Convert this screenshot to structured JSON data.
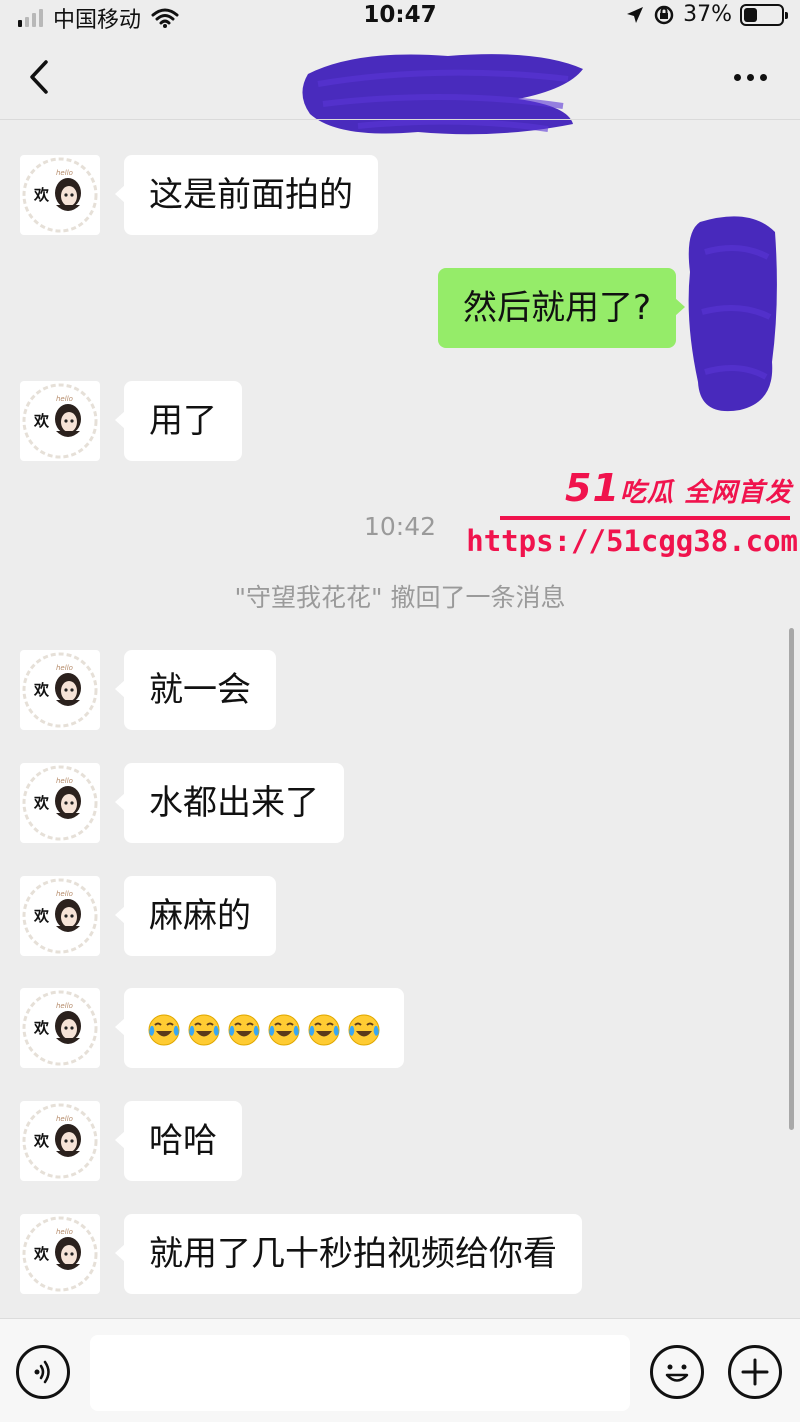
{
  "status_bar": {
    "carrier": "中国移动",
    "time": "10:47",
    "battery_text": "37%",
    "battery_level": 0.37,
    "signal_bars_active": 1,
    "signal_bars_total": 4
  },
  "nav": {
    "title": "",
    "title_redacted": true,
    "back_icon": "chevron-left-icon",
    "more_icon": "ellipsis-icon"
  },
  "messages": [
    {
      "side": "in",
      "text": "这是前面拍的"
    },
    {
      "side": "out",
      "text": "然后就用了?"
    },
    {
      "side": "in",
      "text": "用了"
    },
    {
      "side": "in",
      "text": "就一会"
    },
    {
      "side": "in",
      "text": "水都出来了"
    },
    {
      "side": "in",
      "text": "麻麻的"
    },
    {
      "side": "in",
      "text": "",
      "emoji": "crying-laughing-face",
      "emoji_count": 6
    },
    {
      "side": "in",
      "text": "哈哈"
    },
    {
      "side": "in",
      "text": "就用了几十秒拍视频给你看"
    }
  ],
  "system": {
    "timestamp": "10:42",
    "recall_notice": "\"守望我花花\" 撤回了一条消息"
  },
  "watermark": {
    "brand_number": "51",
    "brand_text": "吃瓜 全网首发",
    "url": "https://51cgg38.com",
    "color": "#f0134d"
  },
  "avatar": {
    "text": "欢"
  },
  "input_bar": {
    "placeholder": "",
    "voice_icon": "voice-icon",
    "emoji_icon": "smiley-icon",
    "plus_icon": "plus-circle-icon"
  },
  "colors": {
    "background": "#ededed",
    "incoming_bubble": "#ffffff",
    "outgoing_bubble": "#95ec69",
    "redaction": "#3b1ab8"
  }
}
